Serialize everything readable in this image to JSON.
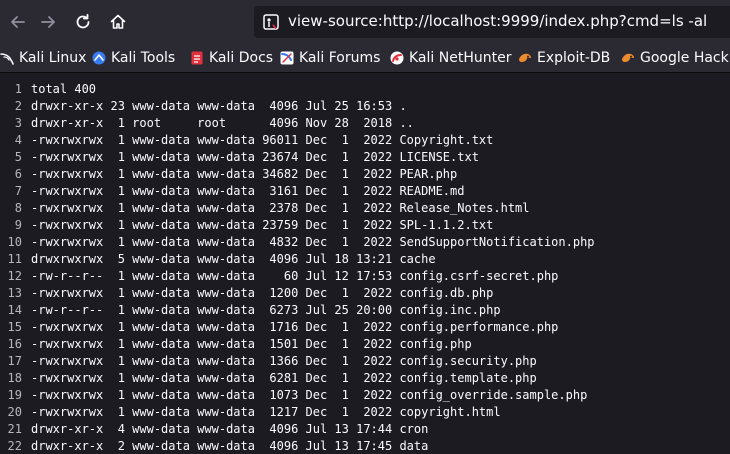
{
  "browser": {
    "back_icon": "arrow-left-icon",
    "forward_icon": "arrow-right-icon",
    "reload_icon": "reload-icon",
    "home_icon": "home-icon",
    "url": "view-source:http://localhost:9999/index.php?cmd=ls -al"
  },
  "bookmarks": [
    {
      "label": "Kali Linux",
      "icon": "kali-icon"
    },
    {
      "label": "Kali Tools",
      "icon": "kali-tools-icon"
    },
    {
      "label": "Kali Docs",
      "icon": "kali-docs-icon"
    },
    {
      "label": "Kali Forums",
      "icon": "kali-forums-icon"
    },
    {
      "label": "Kali NetHunter",
      "icon": "nethunter-icon"
    },
    {
      "label": "Exploit-DB",
      "icon": "exploit-db-icon"
    },
    {
      "label": "Google Hacking",
      "icon": "ghdb-icon"
    }
  ],
  "source_lines": [
    {
      "n": "1",
      "text": "total 400"
    },
    {
      "n": "2",
      "text": "drwxr-xr-x 23 www-data www-data  4096 Jul 25 16:53 ."
    },
    {
      "n": "3",
      "text": "drwxr-xr-x  1 root     root      4096 Nov 28  2018 .."
    },
    {
      "n": "4",
      "text": "-rwxrwxrwx  1 www-data www-data 96011 Dec  1  2022 Copyright.txt"
    },
    {
      "n": "5",
      "text": "-rwxrwxrwx  1 www-data www-data 23674 Dec  1  2022 LICENSE.txt"
    },
    {
      "n": "6",
      "text": "-rwxrwxrwx  1 www-data www-data 34682 Dec  1  2022 PEAR.php"
    },
    {
      "n": "7",
      "text": "-rwxrwxrwx  1 www-data www-data  3161 Dec  1  2022 README.md"
    },
    {
      "n": "8",
      "text": "-rwxrwxrwx  1 www-data www-data  2378 Dec  1  2022 Release_Notes.html"
    },
    {
      "n": "9",
      "text": "-rwxrwxrwx  1 www-data www-data 23759 Dec  1  2022 SPL-1.1.2.txt"
    },
    {
      "n": "10",
      "text": "-rwxrwxrwx  1 www-data www-data  4832 Dec  1  2022 SendSupportNotification.php"
    },
    {
      "n": "11",
      "text": "drwxrwxrwx  5 www-data www-data  4096 Jul 18 13:21 cache"
    },
    {
      "n": "12",
      "text": "-rw-r--r--  1 www-data www-data    60 Jul 12 17:53 config.csrf-secret.php"
    },
    {
      "n": "13",
      "text": "-rwxrwxrwx  1 www-data www-data  1200 Dec  1  2022 config.db.php"
    },
    {
      "n": "14",
      "text": "-rw-r--r--  1 www-data www-data  6273 Jul 25 20:00 config.inc.php"
    },
    {
      "n": "15",
      "text": "-rwxrwxrwx  1 www-data www-data  1716 Dec  1  2022 config.performance.php"
    },
    {
      "n": "16",
      "text": "-rwxrwxrwx  1 www-data www-data  1501 Dec  1  2022 config.php"
    },
    {
      "n": "17",
      "text": "-rwxrwxrwx  1 www-data www-data  1366 Dec  1  2022 config.security.php"
    },
    {
      "n": "18",
      "text": "-rwxrwxrwx  1 www-data www-data  6281 Dec  1  2022 config.template.php"
    },
    {
      "n": "19",
      "text": "-rwxrwxrwx  1 www-data www-data  1073 Dec  1  2022 config_override.sample.php"
    },
    {
      "n": "20",
      "text": "-rwxrwxrwx  1 www-data www-data  1217 Dec  1  2022 copyright.html"
    },
    {
      "n": "21",
      "text": "drwxr-xr-x  4 www-data www-data  4096 Jul 13 17:44 cron"
    },
    {
      "n": "22",
      "text": "drwxr-xr-x  2 www-data www-data  4096 Jul 13 17:45 data"
    }
  ]
}
